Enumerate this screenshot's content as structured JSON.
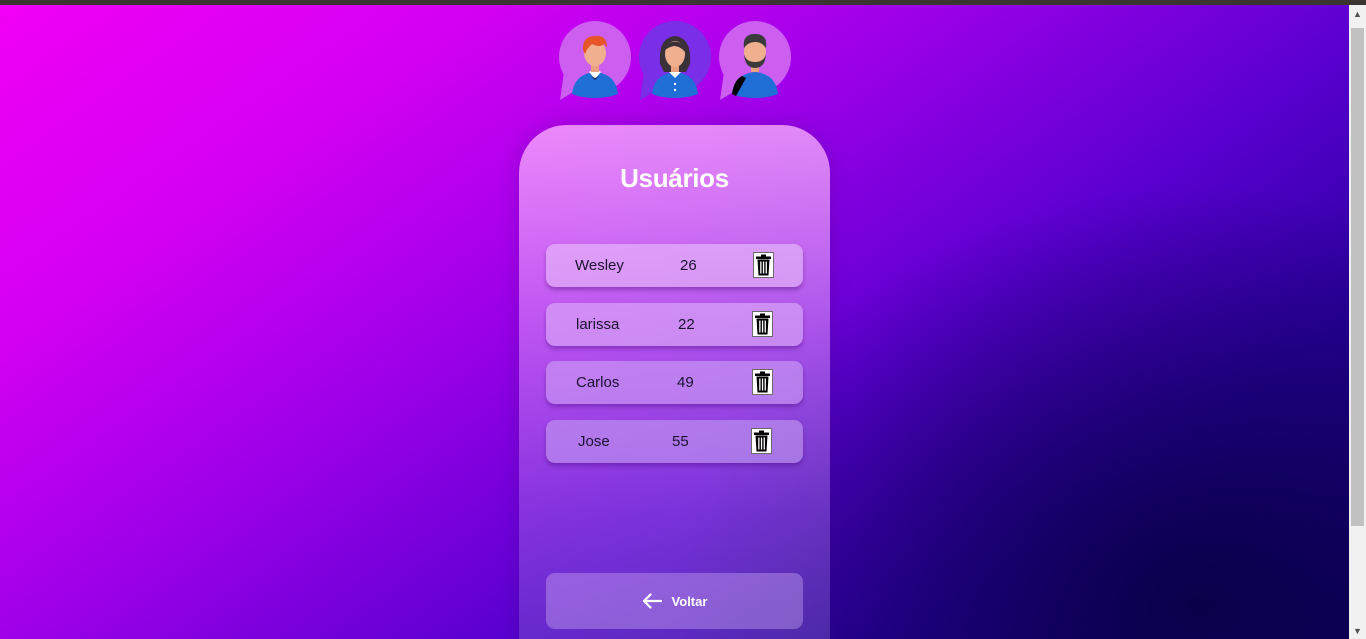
{
  "page": {
    "title": "Usuários"
  },
  "users": [
    {
      "name": "Wesley",
      "age": "26"
    },
    {
      "name": "larissa",
      "age": "22"
    },
    {
      "name": "Carlos",
      "age": "49"
    },
    {
      "name": "Jose",
      "age": "55"
    }
  ],
  "back_button": {
    "label": "Voltar",
    "icon": "arrow-left-icon"
  },
  "icons": {
    "delete": "trash-icon",
    "avatars": [
      "man-avatar-icon",
      "woman-avatar-icon",
      "bearded-man-avatar-icon"
    ]
  },
  "colors": {
    "gradient_start": "#f100f5",
    "gradient_mid": "#5a00d0",
    "gradient_end": "#12006a",
    "title": "#ffffff",
    "avatar_shirt": "#1f6fd6"
  }
}
